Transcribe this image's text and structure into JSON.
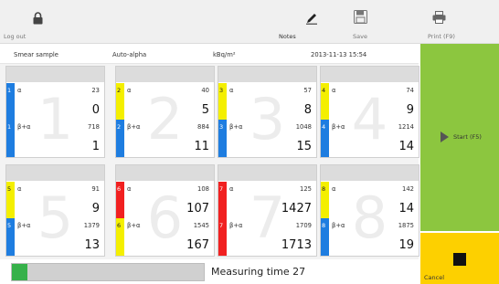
{
  "toolbar": {
    "logout_label": "Log out",
    "logout_icon": "lock-icon",
    "notes_label": "Notes",
    "notes_icon": "pencil-icon",
    "save_label": "Save",
    "save_icon": "floppy-disk-icon",
    "print_label": "Print (F9)",
    "print_icon": "printer-icon"
  },
  "info": {
    "sample": "Smear sample",
    "mode": "Auto-alpha",
    "unit": "kBq/m²",
    "datetime": "2013-11-13 15:54"
  },
  "channels": [
    {
      "num": "1",
      "top_color": "blue",
      "bottom_color": "blue",
      "top_label": "α",
      "top_counts": "23",
      "top_value": "0",
      "bottom_label": "β+α",
      "bottom_counts": "718",
      "bottom_value": "1"
    },
    {
      "num": "2",
      "top_color": "yellow",
      "bottom_color": "blue",
      "top_label": "α",
      "top_counts": "40",
      "top_value": "5",
      "bottom_label": "β+α",
      "bottom_counts": "884",
      "bottom_value": "11"
    },
    {
      "num": "3",
      "top_color": "yellow",
      "bottom_color": "blue",
      "top_label": "α",
      "top_counts": "57",
      "top_value": "8",
      "bottom_label": "β+α",
      "bottom_counts": "1048",
      "bottom_value": "15"
    },
    {
      "num": "4",
      "top_color": "yellow",
      "bottom_color": "blue",
      "top_label": "α",
      "top_counts": "74",
      "top_value": "9",
      "bottom_label": "β+α",
      "bottom_counts": "1214",
      "bottom_value": "14"
    },
    {
      "num": "5",
      "top_color": "yellow",
      "bottom_color": "blue",
      "top_label": "α",
      "top_counts": "91",
      "top_value": "9",
      "bottom_label": "β+α",
      "bottom_counts": "1379",
      "bottom_value": "13"
    },
    {
      "num": "6",
      "top_color": "red",
      "bottom_color": "yellow",
      "top_label": "α",
      "top_counts": "108",
      "top_value": "107",
      "bottom_label": "β+α",
      "bottom_counts": "1545",
      "bottom_value": "167"
    },
    {
      "num": "7",
      "top_color": "red",
      "bottom_color": "red",
      "top_label": "α",
      "top_counts": "125",
      "top_value": "1427",
      "bottom_label": "β+α",
      "bottom_counts": "1709",
      "bottom_value": "1713"
    },
    {
      "num": "8",
      "top_color": "yellow",
      "bottom_color": "blue",
      "top_label": "α",
      "top_counts": "142",
      "top_value": "14",
      "bottom_label": "β+α",
      "bottom_counts": "1875",
      "bottom_value": "19"
    }
  ],
  "colors": {
    "blue": "#1e7de0",
    "yellow": "#f4ef00",
    "red": "#f12020",
    "start_green": "#8cc63f",
    "cancel_yellow": "#fdd000",
    "progress_green": "#36b14a"
  },
  "start": {
    "label": "Start (F5)",
    "icon": "play-arrow-icon"
  },
  "cancel": {
    "label": "Cancel",
    "icon": "stop-square-icon"
  },
  "status": {
    "measuring_text": "Measuring time 27",
    "progress_fraction": 0.08
  }
}
